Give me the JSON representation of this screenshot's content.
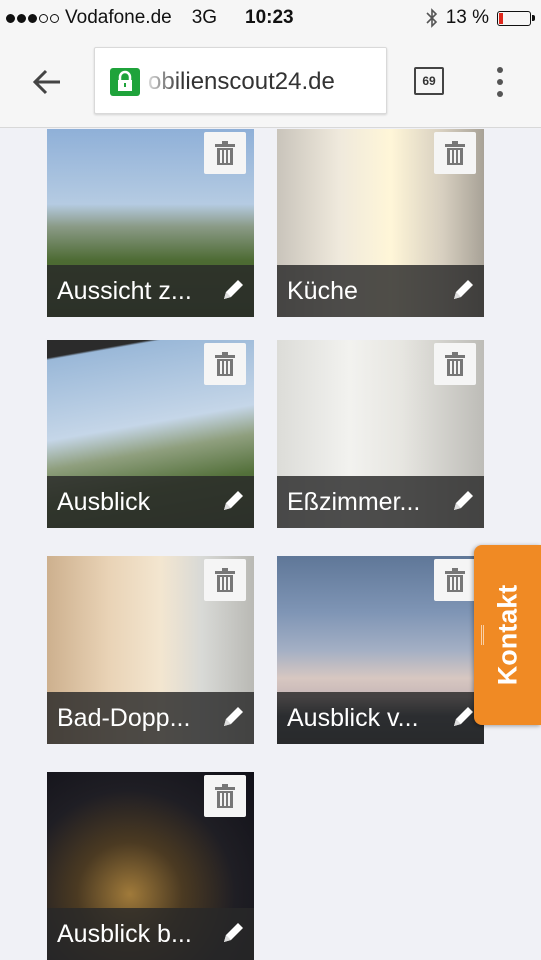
{
  "status": {
    "carrier": "Vodafone.de",
    "network": "3G",
    "time": "10:23",
    "battery": "13 %",
    "battery_level": 0.13
  },
  "browser": {
    "url": "obilienscout24.de",
    "tab_count": "69"
  },
  "gallery": [
    {
      "label": "Aussicht z..."
    },
    {
      "label": "Küche"
    },
    {
      "label": "Ausblick"
    },
    {
      "label": "Eßzimmer..."
    },
    {
      "label": "Bad-Dopp..."
    },
    {
      "label": "Ausblick v..."
    },
    {
      "label": "Ausblick b..."
    }
  ],
  "kontakt": {
    "label": "Kontakt"
  },
  "colors": {
    "accent": "#f08a24",
    "lock": "#1fa33b",
    "background": "#f0f1f6"
  }
}
